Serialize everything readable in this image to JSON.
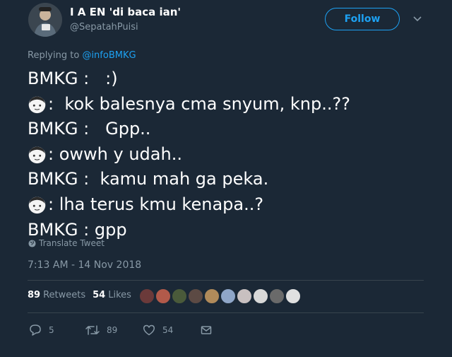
{
  "user": {
    "display_name": "I A EN 'di baca ian'",
    "handle": "@SepatahPuisi"
  },
  "header": {
    "follow_label": "Follow"
  },
  "reply": {
    "prefix": "Replying to ",
    "mention": "@infoBMKG"
  },
  "tweet": {
    "lines": [
      "BMKG :   :)",
      ":  kok balesnya cma snyum, knp..??",
      "BMKG :   Gpp..",
      ": owwh y udah..",
      "BMKG :  kamu mah ga peka.",
      ": lha terus kmu kenapa..?",
      "BMKG : gpp"
    ],
    "translate_label": "Translate Tweet",
    "timestamp": "7:13 AM - 14 Nov 2018"
  },
  "stats": {
    "retweets_count": "89",
    "retweets_label": "Retweets",
    "likes_count": "54",
    "likes_label": "Likes"
  },
  "actions": {
    "reply_count": "5",
    "retweet_count": "89",
    "like_count": "54"
  },
  "colors": {
    "background": "#1b2836",
    "accent": "#1da1f2",
    "muted": "#8899a6",
    "divider": "#38444d"
  }
}
